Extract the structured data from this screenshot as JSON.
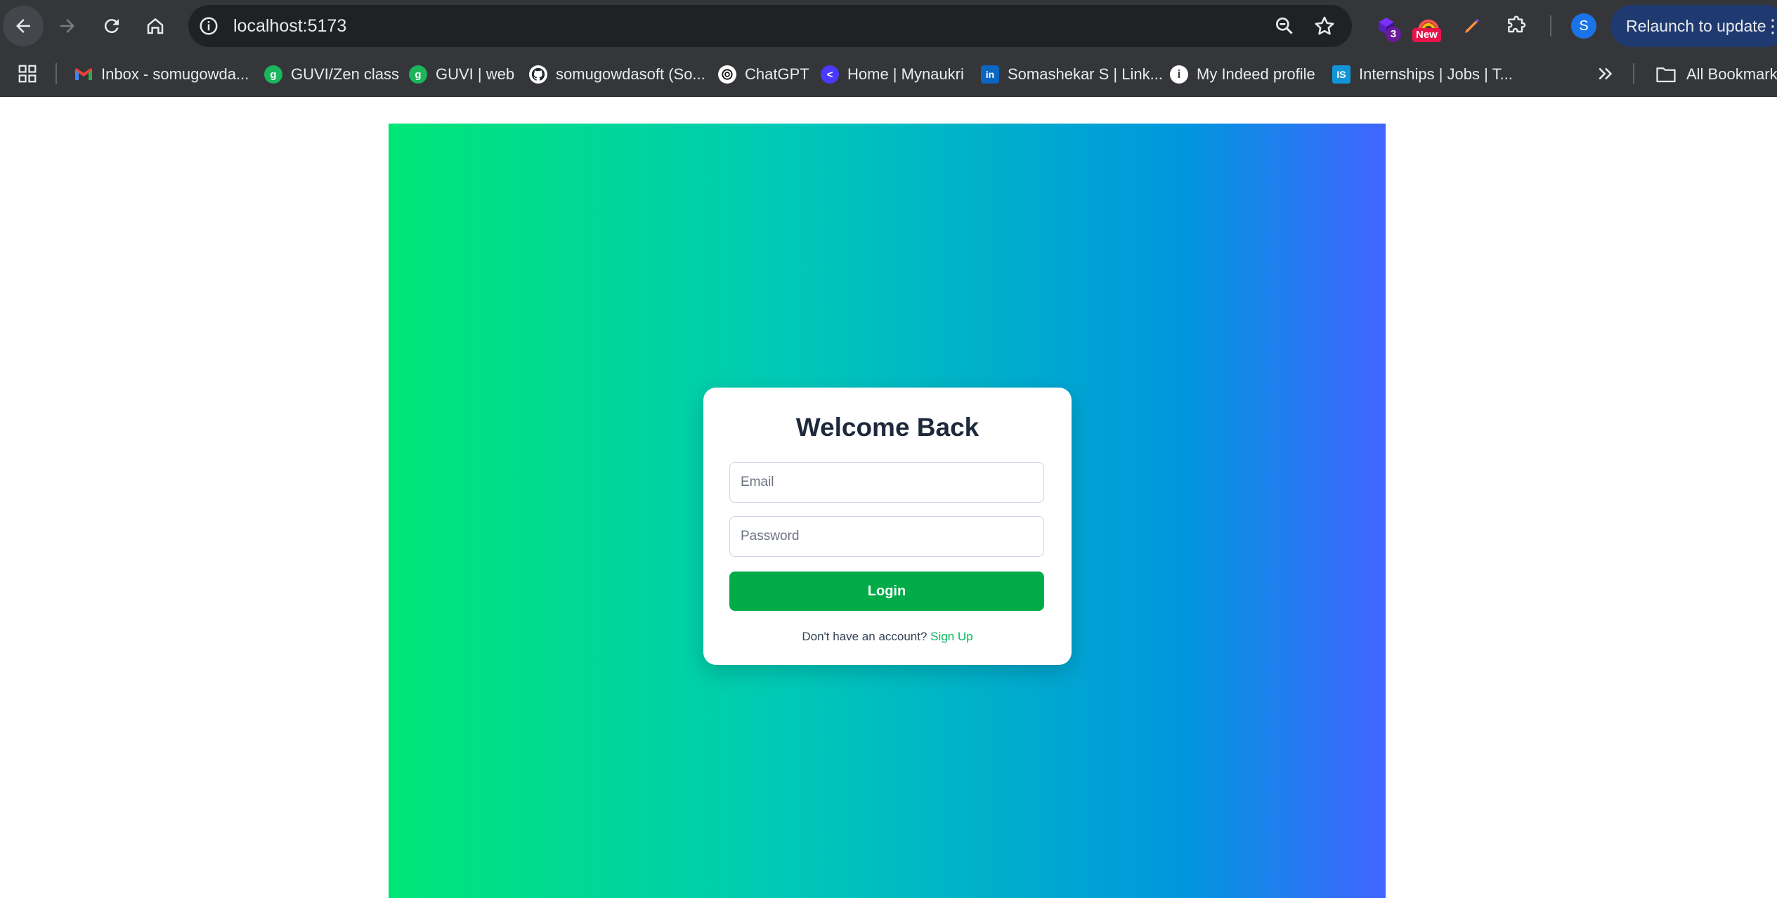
{
  "browser": {
    "url": "localhost:5173",
    "extensions": {
      "badge_count": "3",
      "new_badge": "New"
    },
    "profile_initial": "S",
    "relaunch_label": "Relaunch to update"
  },
  "bookmarks": {
    "items": [
      {
        "label": "Inbox - somugowda...",
        "icon": "gmail-icon",
        "color": "#ea4335"
      },
      {
        "label": "GUVI/Zen class",
        "icon": "guvi-icon",
        "color": "#1bb55c"
      },
      {
        "label": "GUVI | web",
        "icon": "guvi-icon",
        "color": "#1bb55c"
      },
      {
        "label": "somugowdasoft (So...",
        "icon": "github-icon",
        "color": "#ffffff"
      },
      {
        "label": "ChatGPT",
        "icon": "chatgpt-icon",
        "color": "#ffffff"
      },
      {
        "label": "Home | Mynaukri",
        "icon": "naukri-icon",
        "color": "#4a3aff"
      },
      {
        "label": "Somashekar S | Link...",
        "icon": "linkedin-icon",
        "color": "#0a66c2"
      },
      {
        "label": "My Indeed profile",
        "icon": "info-icon",
        "color": "#ffffff"
      },
      {
        "label": "Internships | Jobs | T...",
        "icon": "internshala-icon",
        "color": "#1295d8"
      }
    ],
    "all_bookmarks_label": "All Bookmarks"
  },
  "login": {
    "title": "Welcome Back",
    "email_placeholder": "Email",
    "password_placeholder": "Password",
    "login_label": "Login",
    "signup_prompt": "Don't have an account?",
    "signup_link": "Sign Up"
  },
  "colors": {
    "gradient_start": "#00e676",
    "gradient_end": "#4264ff",
    "login_button": "#00ab48",
    "signup_link": "#00b85a"
  }
}
